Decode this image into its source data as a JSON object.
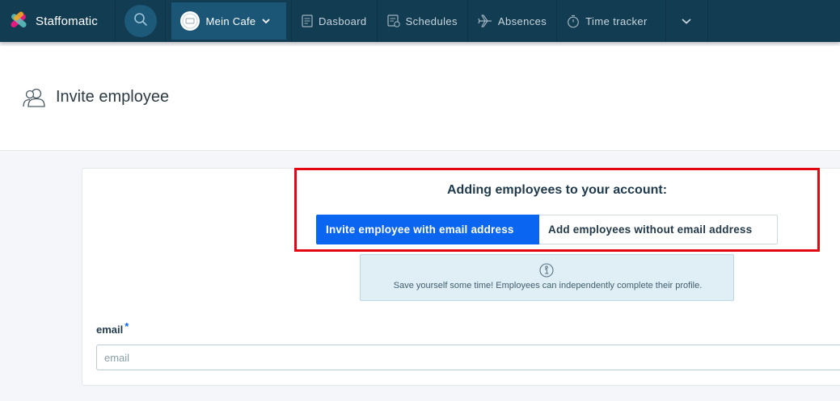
{
  "nav": {
    "brand": "Staffomatic",
    "location": "Mein Cafe",
    "items": [
      {
        "label": "Dasboard",
        "icon": "dashboard-icon"
      },
      {
        "label": "Schedules",
        "icon": "schedules-icon"
      },
      {
        "label": "Absences",
        "icon": "plane-icon"
      },
      {
        "label": "Time tracker",
        "icon": "stopwatch-icon"
      }
    ]
  },
  "page": {
    "title": "Invite employee"
  },
  "form": {
    "section_title": "Adding employees to your account:",
    "option_with_email": "Invite employee with email address",
    "option_without_email": "Add employees without email address",
    "info_text": "Save yourself some time! Employees can independently complete their profile.",
    "email_label": "email",
    "required_mark": "*",
    "email_placeholder": "email",
    "email_value": ""
  },
  "colors": {
    "nav_bg": "#123c52",
    "accent": "#0a66f0",
    "highlight": "#e30613",
    "info_bg": "#e0eef6"
  }
}
